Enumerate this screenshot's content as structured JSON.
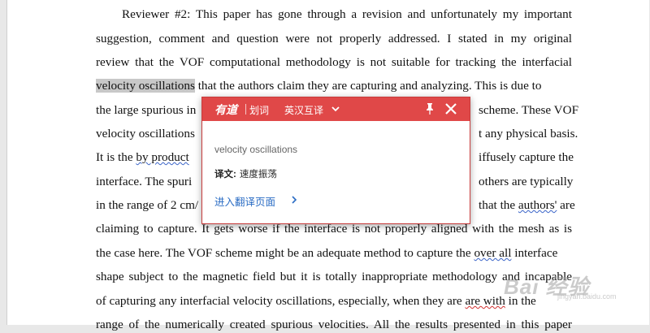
{
  "document": {
    "lines": [
      "Reviewer #2: This paper has gone through a revision and unfortunately my important",
      "suggestion, comment and question were not properly addressed. I stated in my original",
      "review that the VOF computational methodology is not suitable for tracking the interfacial",
      "that the authors claim they are capturing and analyzing. This is due to",
      "the large spurious in",
      "scheme. These VOF",
      "velocity oscillations",
      "t any physical basis.",
      "It is the",
      "iffusely capture the",
      "interface. The spuri",
      "others are typically",
      "in the range of 2 cm/",
      "that the",
      "are",
      "claiming to capture. It gets worse if the interface is not properly aligned with the mesh as is",
      "the case here. The VOF scheme might be an adequate method to capture the",
      "interface",
      "shape subject to the magnetic field but it is totally inappropriate methodology and incapable",
      "of capturing any interfacial velocity oscillations, especially, when they are",
      "in the",
      "range of the numerically created spurious velocities. All the results presented in this paper"
    ],
    "highlighted": "velocity oscillations",
    "byproduct": "by product",
    "authors": "authors'",
    "overall": "over all",
    "are_with": "are with"
  },
  "popup": {
    "brand": "有道",
    "mode": "划词",
    "direction": "英汉互译",
    "source": "velocity oscillations",
    "translation_label": "译文:",
    "translation": "速度振荡",
    "link": "进入翻译页面",
    "colors": {
      "header": "#e04848",
      "link": "#2a6cc4"
    },
    "icons": [
      "chevron-down-icon",
      "pin-icon",
      "close-icon",
      "chevron-right-icon"
    ]
  },
  "watermark": {
    "main": "Bai 经验",
    "sub": "jingyan.baidu.com"
  }
}
